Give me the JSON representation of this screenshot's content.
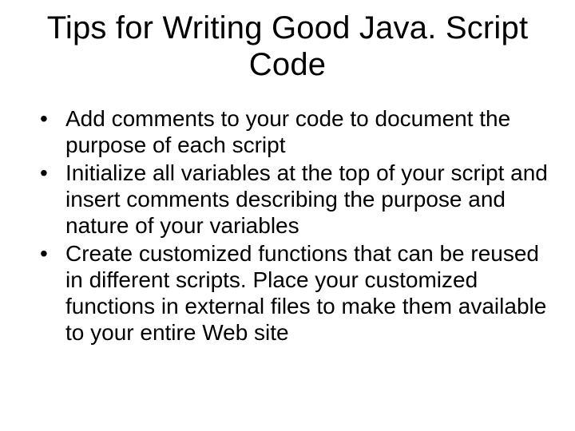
{
  "slide": {
    "title": "Tips for Writing Good Java. Script Code",
    "bullets": [
      "Add comments to your code to document the purpose of each script",
      "Initialize all variables at the top of your script and insert comments describing the purpose and nature of your variables",
      "Create customized functions that can be reused in different scripts.  Place your customized functions in external files to make them available to your entire Web site"
    ]
  }
}
